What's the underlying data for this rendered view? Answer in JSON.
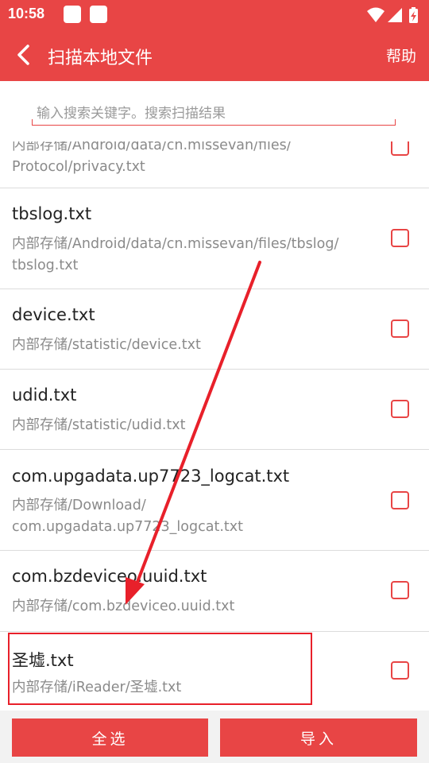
{
  "status_bar": {
    "time": "10:58",
    "icons": [
      "notification-square-icon",
      "notification-square-icon",
      "wifi-icon",
      "signal-icon",
      "battery-charging-icon"
    ]
  },
  "app_bar": {
    "title": "扫描本地文件",
    "back_icon": "chevron-left-icon",
    "help_label": "帮助"
  },
  "search": {
    "placeholder": "输入搜索关键字。搜索扫描结果",
    "value": ""
  },
  "files": [
    {
      "name": "",
      "path_lines": [
        "内部存储/Android/data/cn.missevan/files/",
        "Protocol/privacy.txt"
      ],
      "checked": false
    },
    {
      "name": "tbslog.txt",
      "path_lines": [
        "内部存储/Android/data/cn.missevan/files/tbslog/",
        "tbslog.txt"
      ],
      "checked": false
    },
    {
      "name": "device.txt",
      "path_lines": [
        "内部存储/statistic/device.txt"
      ],
      "checked": false
    },
    {
      "name": "udid.txt",
      "path_lines": [
        "内部存储/statistic/udid.txt"
      ],
      "checked": false
    },
    {
      "name": "com.upgadata.up7723_logcat.txt",
      "path_lines": [
        "内部存储/Download/",
        "com.upgadata.up7723_logcat.txt"
      ],
      "checked": false
    },
    {
      "name": "com.bzdeviceo.uuid.txt",
      "path_lines": [
        "内部存储/com.bzdeviceo.uuid.txt"
      ],
      "checked": false
    },
    {
      "name": "圣墟.txt",
      "path_lines": [
        "内部存储/iReader/圣墟.txt"
      ],
      "checked": false
    }
  ],
  "bottom": {
    "select_all_label": "全选",
    "import_label": "导入"
  },
  "colors": {
    "brand_red": "#e84545",
    "annotation_red": "#e8202a",
    "path_gray": "#8a8a8a"
  }
}
